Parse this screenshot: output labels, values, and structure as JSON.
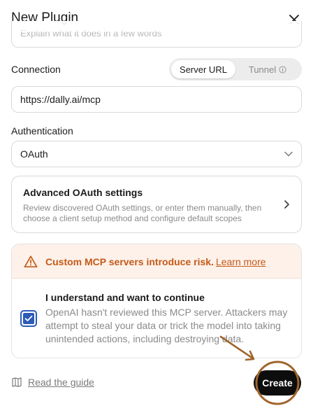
{
  "dialog": {
    "title": "New Plugin",
    "description_placeholder": "Explain what it does in a few words"
  },
  "connection": {
    "label": "Connection",
    "options": [
      {
        "label": "Server URL",
        "active": true
      },
      {
        "label": "Tunnel",
        "active": false
      }
    ],
    "url_value": "https://dally.ai/mcp"
  },
  "authentication": {
    "label": "Authentication",
    "selected": "OAuth"
  },
  "advanced": {
    "title": "Advanced OAuth settings",
    "description": "Review discovered OAuth settings, or enter them manually, then choose a client setup method and configure default scopes"
  },
  "risk": {
    "warning": "Custom MCP servers introduce risk.",
    "learn_more": "Learn more",
    "consent_title": "I understand and want to continue",
    "consent_desc": "OpenAI hasn't reviewed this MCP server. Attackers may attempt to steal your data or trick the model into taking unintended actions, including destroying data.",
    "checked": true
  },
  "footer": {
    "guide": "Read the guide",
    "create": "Create"
  },
  "colors": {
    "accent_checkbox": "#2b5bb8",
    "warning_text": "#c45a17",
    "warning_bg": "#fdf1ea",
    "annotation": "#a0662c"
  },
  "icons": {
    "close": "close-icon",
    "tunnel_info": "info-icon",
    "select": "chevron-down-icon",
    "advanced": "chevron-right-icon",
    "warning": "warning-triangle-icon",
    "check": "check-icon",
    "guide": "book-icon"
  }
}
